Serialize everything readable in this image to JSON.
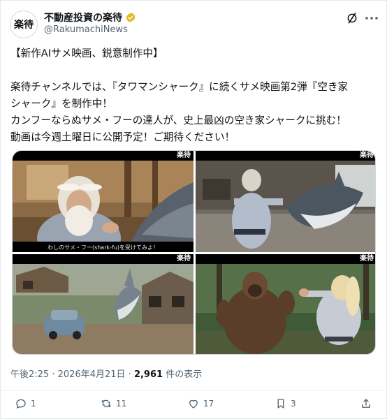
{
  "account": {
    "avatar_text": "楽待",
    "display_name": "不動産投資の楽待",
    "handle": "@RakumachiNews"
  },
  "post": {
    "lines": [
      "【新作AIサメ映画、鋭意制作中】",
      "楽待チャンネルでは、『タワマンシャーク』に続くサメ映画第2弾『空き家",
      "シャーク』を制作中！",
      "カンフーならぬサメ・フーの達人が、史上最凶の空き家シャークに挑む！",
      "動画は今週土曜日に公開予定！ご期待ください！"
    ]
  },
  "media": {
    "watermark": "楽待",
    "caption": "わしのサメ・フー(shark-fu)を受けてみよ！"
  },
  "meta": {
    "time": "午後2:25",
    "separator": "·",
    "date": "2026年4月21日",
    "views": "2,961",
    "views_label": "件の表示"
  },
  "actions": {
    "reply_count": "1",
    "repost_count": "11",
    "like_count": "17",
    "bookmark_count": "3"
  },
  "colors": {
    "text": "#0f1419",
    "muted": "#536471",
    "verified": "#e2b719"
  }
}
